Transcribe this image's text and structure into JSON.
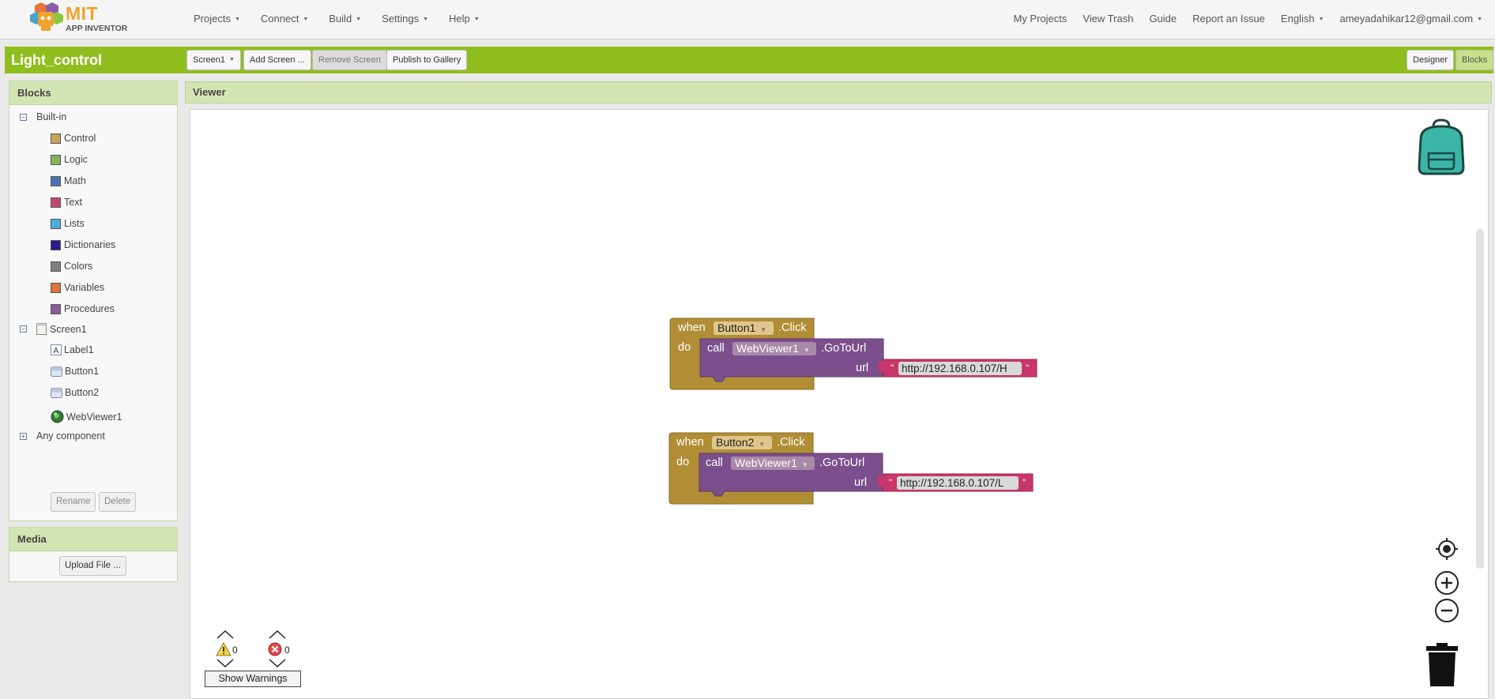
{
  "brand": {
    "line1": "MIT",
    "line2": "APP INVENTOR",
    "colors": {
      "orange": "#f0a32b",
      "green": "#8fbe1e"
    }
  },
  "nav": {
    "left": [
      {
        "label": "Projects",
        "has_caret": true
      },
      {
        "label": "Connect",
        "has_caret": true
      },
      {
        "label": "Build",
        "has_caret": true
      },
      {
        "label": "Settings",
        "has_caret": true
      },
      {
        "label": "Help",
        "has_caret": true
      }
    ],
    "right": [
      {
        "label": "My Projects",
        "has_caret": false
      },
      {
        "label": "View Trash",
        "has_caret": false
      },
      {
        "label": "Guide",
        "has_caret": false
      },
      {
        "label": "Report an Issue",
        "has_caret": false
      },
      {
        "label": "English",
        "has_caret": true
      },
      {
        "label": "ameyadahikar12@gmail.com",
        "has_caret": true
      }
    ]
  },
  "project": {
    "title": "Light_control",
    "screen_select": "Screen1",
    "add_screen": "Add Screen ...",
    "remove_screen": "Remove Screen",
    "publish": "Publish to Gallery",
    "designer": "Designer",
    "blocks": "Blocks"
  },
  "blocks_panel": {
    "title": "Blocks",
    "builtin_label": "Built-in",
    "builtin_items": [
      {
        "label": "Control",
        "color": "#c9a35c"
      },
      {
        "label": "Logic",
        "color": "#84b35a"
      },
      {
        "label": "Math",
        "color": "#4a72b0"
      },
      {
        "label": "Text",
        "color": "#c24a70"
      },
      {
        "label": "Lists",
        "color": "#4bb0d8"
      },
      {
        "label": "Dictionaries",
        "color": "#2a1a8a"
      },
      {
        "label": "Colors",
        "color": "#808080"
      },
      {
        "label": "Variables",
        "color": "#e0743a"
      },
      {
        "label": "Procedures",
        "color": "#8a5a9a"
      }
    ],
    "screen_label": "Screen1",
    "components": [
      {
        "label": "Label1",
        "icon": "label-icon"
      },
      {
        "label": "Button1",
        "icon": "button-icon"
      },
      {
        "label": "Button2",
        "icon": "button-icon"
      },
      {
        "label": "WebViewer1",
        "icon": "globe-icon"
      }
    ],
    "any_component": "Any component",
    "rename": "Rename",
    "delete": "Delete"
  },
  "media_panel": {
    "title": "Media",
    "upload": "Upload File ..."
  },
  "viewer": {
    "title": "Viewer",
    "events": [
      {
        "when": "when",
        "component": "Button1",
        "event": ".Click",
        "do": "do",
        "call": "call",
        "target": "WebViewer1",
        "method": ".GoToUrl",
        "param": "url",
        "url": "http://192.168.0.107/H"
      },
      {
        "when": "when",
        "component": "Button2",
        "event": ".Click",
        "do": "do",
        "call": "call",
        "target": "WebViewer1",
        "method": ".GoToUrl",
        "param": "url",
        "url": "http://192.168.0.107/L"
      }
    ],
    "warnings_count": "0",
    "errors_count": "0",
    "show_warnings": "Show Warnings"
  }
}
